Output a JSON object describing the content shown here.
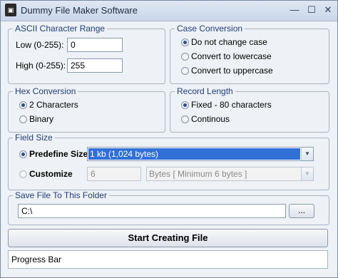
{
  "window": {
    "title": "Dummy File Maker Software",
    "icon_name": "app-icon",
    "controls": {
      "minimize": "—",
      "maximize": "☐",
      "close": "✕"
    }
  },
  "ascii": {
    "legend": "ASCII Character Range",
    "low_label": "Low (0-255):",
    "low_value": "0",
    "high_label": "High (0-255):",
    "high_value": "255"
  },
  "case": {
    "legend": "Case Conversion",
    "options": [
      "Do not change case",
      "Convert to lowercase",
      "Convert to uppercase"
    ],
    "selected": "Do not change case"
  },
  "hex": {
    "legend": "Hex Conversion",
    "options": [
      "2 Characters",
      "Binary"
    ],
    "selected": "2 Characters"
  },
  "record": {
    "legend": "Record Length",
    "options": [
      "Fixed - 80 characters",
      "Continous"
    ],
    "selected": "Fixed - 80 characters"
  },
  "field": {
    "legend": "Field Size",
    "predefine_label": "Predefine Size",
    "predefine_value": "1 kb (1,024 bytes)",
    "customize_label": "Customize",
    "customize_value": "6",
    "unit_value": "Bytes [ Minimum 6 bytes ]",
    "selected": "Predefine Size"
  },
  "save": {
    "legend": "Save File To This Folder",
    "path_value": "C:\\",
    "browse_label": "..."
  },
  "start_button": "Start Creating File",
  "progress_text": "Progress Bar",
  "colors": {
    "legend_text": "#1f3e7a",
    "selection": "#3170d6",
    "panel_background": "#eef1f5"
  }
}
